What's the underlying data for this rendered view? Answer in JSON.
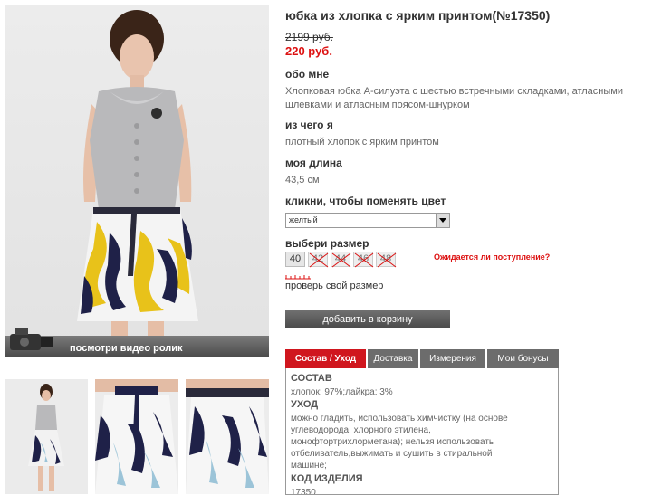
{
  "product": {
    "title": "юбка из хлопка с ярким принтом(№17350)",
    "old_price": "2199 руб.",
    "new_price": "220 руб."
  },
  "about": {
    "heading": "обо мне",
    "text_line1": "Хлопковая юбка А-силуэта с шестью встречными складками, атласными",
    "text_line2": "шлевками и атласным поясом-шнурком"
  },
  "material": {
    "heading": "из чего я",
    "text": "плотный хлопок с ярким принтом"
  },
  "length": {
    "heading": "моя длина",
    "text": "43,5 см"
  },
  "color": {
    "heading": "кликни, чтобы поменять цвет",
    "selected": "желтый"
  },
  "size": {
    "heading": "выбери размер",
    "options": [
      "40",
      "42",
      "44",
      "46",
      "48"
    ],
    "awaiting": "Ожидается ли поступление?",
    "check_link": "проверь свой размер"
  },
  "cart": {
    "button": "добавить в корзину"
  },
  "gallery": {
    "video_label": "посмотри видео ролик"
  },
  "tabs": [
    "Состав / Уход",
    "Доставка",
    "Измерения",
    "Мои бонусы"
  ],
  "tab_content": {
    "composition_h": "СОСТАВ",
    "composition": "хлопок: 97%;лайкра: 3%",
    "care_h": "УХОД",
    "care_line1": "можно гладить, использовать химчистку (на основе",
    "care_line2": "углеводорода, хлорного этилена,",
    "care_line3": "монофтортрихлорметана); нельзя использовать",
    "care_line4": "отбеливатель,выжимать и сушить в стиральной",
    "care_line5": "машине;",
    "code_h": "КОД ИЗДЕЛИЯ",
    "code": "17350"
  },
  "colors": {
    "accent_red": "#d0161e",
    "price_red": "#dd1111",
    "tab_gray": "#6c6c6c",
    "skirt_yellow": "#e8c21a"
  }
}
